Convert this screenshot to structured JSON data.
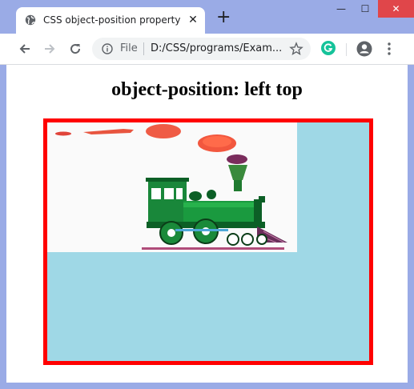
{
  "browser": {
    "tab_title": "CSS object-position property",
    "new_tab_symbol": "+",
    "tab_close_symbol": "✕",
    "omnibox": {
      "scheme_label": "File",
      "url": "D:/CSS/programs/Exam..."
    },
    "window_controls": {
      "minimize": "—",
      "maximize": "☐",
      "close": "✕"
    },
    "icons": {
      "favicon": "globe-icon",
      "back": "arrow-left-icon",
      "forward": "arrow-right-icon",
      "reload": "reload-icon",
      "info": "info-icon",
      "star": "star-icon",
      "extension": "grammarly-icon",
      "profile": "account-icon",
      "menu": "kebab-menu-icon"
    }
  },
  "page": {
    "heading": "object-position: left top",
    "frame": {
      "border_color": "#ff0000",
      "background_color": "#9fd8e6"
    },
    "image": {
      "subject": "steam-locomotive",
      "alt": "train"
    }
  },
  "colors": {
    "chrome_frame": "#9aabe6",
    "close_button": "#e0464a",
    "grammarly": "#15c39a"
  }
}
